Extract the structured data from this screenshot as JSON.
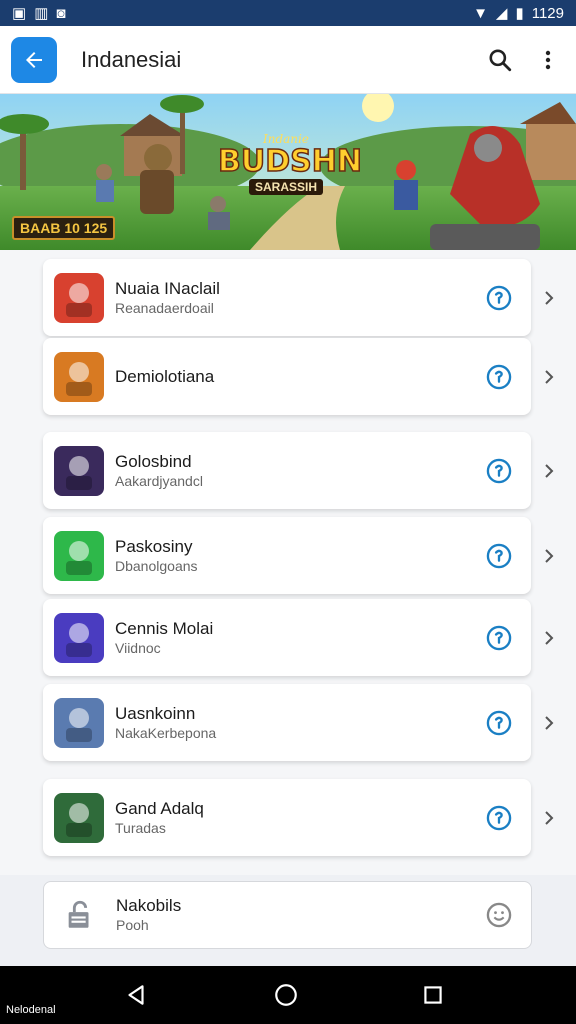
{
  "status_bar": {
    "left_icons": [
      "sim-icon",
      "signal-icon",
      "notification-icon"
    ],
    "time": "1129"
  },
  "app_bar": {
    "title": "Indanesiai"
  },
  "banner": {
    "logo_top": "Indanie",
    "logo_main": "BUDSHN",
    "logo_sub": "SARASSIH",
    "badge": "BAAB 10 125"
  },
  "list_items": [
    {
      "name": "Nuaia INaclail",
      "subtitle": "Reanadaerdoail",
      "icon_color": "#d8412f"
    },
    {
      "name": "Demiolotiana",
      "subtitle": "",
      "icon_color": "#d87a22"
    },
    {
      "name": "Golosbind",
      "subtitle": "Aakardjyandcl",
      "icon_color": "#3a2a5c"
    },
    {
      "name": "Paskosiny",
      "subtitle": "Dbanolgoans",
      "icon_color": "#2eb84a"
    },
    {
      "name": "Cennis Molai",
      "subtitle": "Viidnoc",
      "icon_color": "#4a3cc0"
    },
    {
      "name": "Uasnkoinn",
      "subtitle": "NakaKerbepona",
      "icon_color": "#5a7bb0"
    },
    {
      "name": "Gand Adalq",
      "subtitle": "Turadas",
      "icon_color": "#2f6b3a"
    }
  ],
  "bottom_card": {
    "name": "Nakobils",
    "subtitle": "Pooh"
  },
  "nav_bar": {
    "label": "Nelodenal"
  },
  "colors": {
    "primary": "#1e88e5",
    "status_bar": "#1b3d6e",
    "info_icon": "#1a7fc4"
  }
}
